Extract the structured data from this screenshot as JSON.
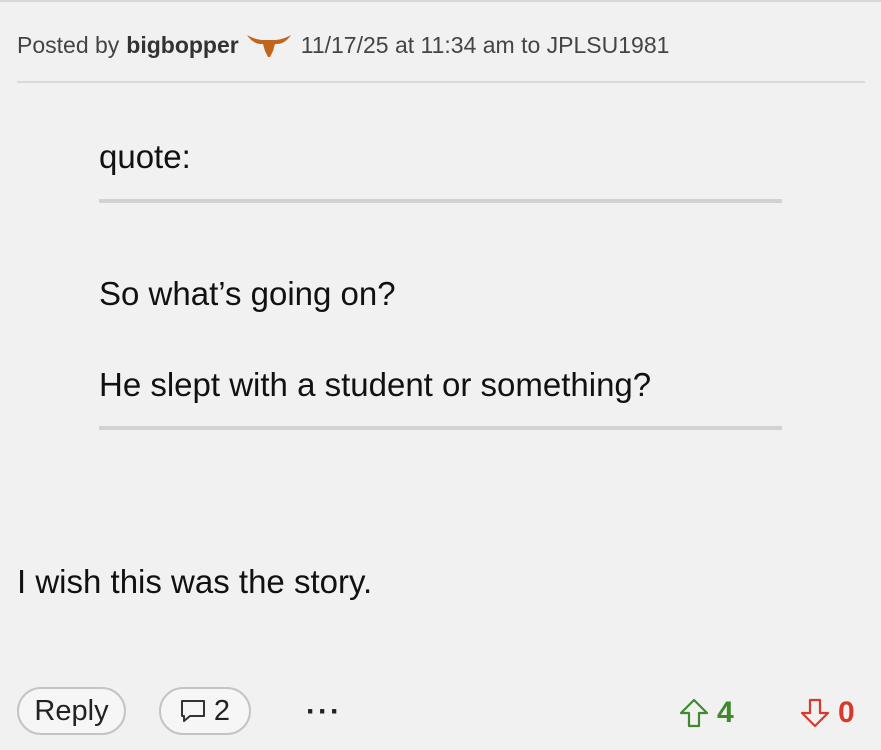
{
  "post": {
    "posted_by_label": "Posted by",
    "author": "bigbopper",
    "team_logo": "longhorn-icon",
    "meta": "11/17/25 at 11:34 am to JPLSU1981"
  },
  "quote": {
    "label": "quote:",
    "lines": [
      "So what’s going on?",
      "He slept with a student or something?"
    ]
  },
  "body": {
    "text": "I wish this was the story."
  },
  "actions": {
    "reply_label": "Reply",
    "comment_count": "2",
    "more_label": "···",
    "upvotes": "4",
    "downvotes": "0"
  },
  "colors": {
    "background": "#f1f1f1",
    "upvote": "#3f8a2f",
    "downvote": "#d63a2a",
    "logo": "#c0651b"
  }
}
